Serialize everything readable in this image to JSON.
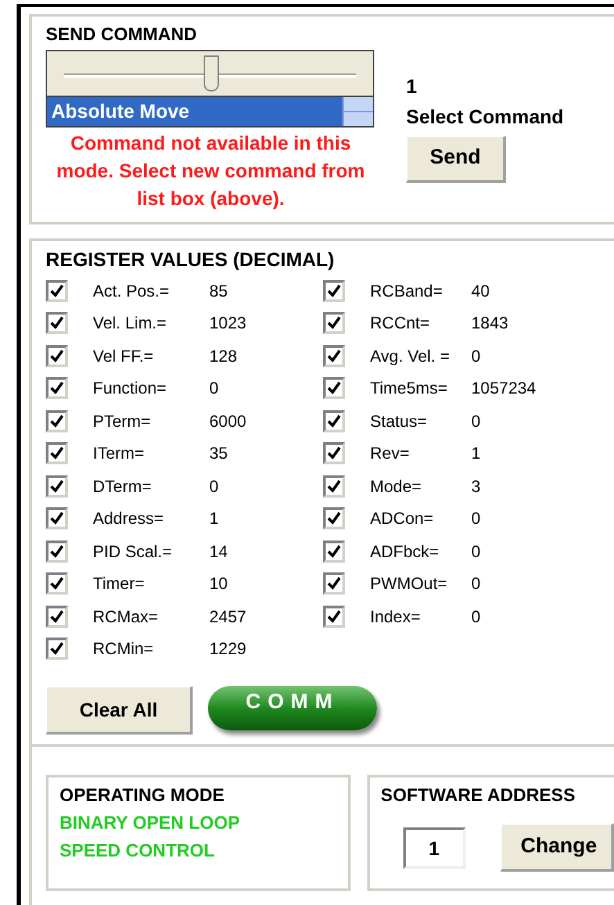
{
  "send_command": {
    "title": "SEND COMMAND",
    "slider": {
      "level": 0.5
    },
    "command_list": {
      "value": "Absolute Move",
      "selected": true
    },
    "error_message": "Command not available in this mode.  Select new command from list box (above).",
    "command_number": "1",
    "command_label": "Select Command",
    "send_button": "Send"
  },
  "register_values": {
    "title": "REGISTER VALUES (DECIMAL)",
    "left_column": [
      {
        "label": "Act. Pos.=",
        "value": "85",
        "checked": true
      },
      {
        "label": "Vel. Lim.=",
        "value": "1023",
        "checked": true
      },
      {
        "label": "Vel FF.=",
        "value": "128",
        "checked": true
      },
      {
        "label": "Function=",
        "value": "0",
        "checked": true
      },
      {
        "label": "PTerm=",
        "value": "6000",
        "checked": true
      },
      {
        "label": "ITerm=",
        "value": "35",
        "checked": true
      },
      {
        "label": "DTerm=",
        "value": "0",
        "checked": true
      },
      {
        "label": "Address=",
        "value": "1",
        "checked": true
      },
      {
        "label": "PID Scal.=",
        "value": "14",
        "checked": true
      },
      {
        "label": "Timer=",
        "value": "10",
        "checked": true
      },
      {
        "label": "RCMax=",
        "value": "2457",
        "checked": true
      },
      {
        "label": "RCMin=",
        "value": "1229",
        "checked": true
      }
    ],
    "right_column": [
      {
        "label": "RCBand=",
        "value": "40",
        "checked": true
      },
      {
        "label": "RCCnt=",
        "value": "1843",
        "checked": true
      },
      {
        "label": "Avg. Vel. =",
        "value": "0",
        "checked": true
      },
      {
        "label": "Time5ms=",
        "value": "1057234",
        "checked": true
      },
      {
        "label": "Status=",
        "value": "0",
        "checked": true
      },
      {
        "label": "Rev=",
        "value": "1",
        "checked": true
      },
      {
        "label": "Mode=",
        "value": "3",
        "checked": true
      },
      {
        "label": "ADCon=",
        "value": "0",
        "checked": true
      },
      {
        "label": "ADFbck=",
        "value": "0",
        "checked": true
      },
      {
        "label": "PWMOut=",
        "value": "0",
        "checked": true
      },
      {
        "label": "Index=",
        "value": "0",
        "checked": true
      }
    ],
    "clear_all_button": "Clear All",
    "comm_button": "COMM"
  },
  "operating_mode": {
    "title": "OPERATING MODE",
    "lines": [
      "BINARY OPEN LOOP",
      "SPEED CONTROL"
    ]
  },
  "software_address": {
    "title": "SOFTWARE ADDRESS",
    "value": "1",
    "change_button": "Change"
  }
}
